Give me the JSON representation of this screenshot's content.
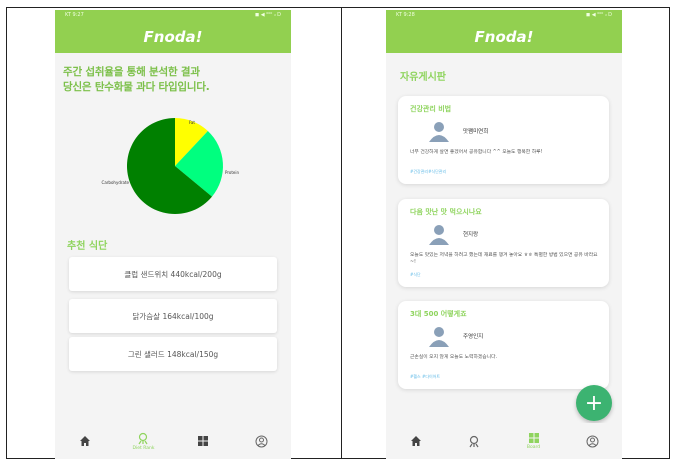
{
  "status_bar": {
    "left_time": "KT 9:27",
    "right_time": "KT 9:28",
    "indicators": "◼ ◀ ⁰⁰⁰ ᵢₗ D"
  },
  "app": {
    "title": "Fnoda!"
  },
  "analysis": {
    "line1": "주간 섭취율을 통해 분석한 결과",
    "line2": "당신은 탄수화물 과다 타입입니다."
  },
  "chart_data": {
    "type": "pie",
    "labels": [
      "Carbohydrate",
      "Protein",
      "Fat"
    ],
    "values": [
      64,
      24,
      12
    ],
    "colors": [
      "#008000",
      "#00ff7f",
      "#ffff00"
    ]
  },
  "recommend": {
    "title": "추천 식단",
    "items": [
      "클럽 샌드위치 440kcal/200g",
      "닭가슴살 164kcal/100g",
      "그린 샐러드 148kcal/150g"
    ]
  },
  "board": {
    "title": "자유게시판",
    "posts": [
      {
        "title": "건강관리 비법",
        "author": "맛쨈미연희",
        "body": "너무 건강하게 살면 좋겠어서 공유합니다 ^^ 오늘도 행복한 하루!",
        "tag": "#건강관리#식단관리"
      },
      {
        "title": "다음 맛난 맛 먹으시나요",
        "author": "현지랑",
        "body": "오늘도 맛있는 저녁을 하려고 했는데 재료를 챙겨 놓아요 ㅎㅎ 특별한 방법 있으면 공유 바라요~!",
        "tag": "#식단"
      },
      {
        "title": "3대 500 어떻게죠",
        "author": "주영인지",
        "body": "근손실이 오지 않게 오늘도 노력하겠습니다.",
        "tag": "#헬스 #다이어트"
      }
    ]
  },
  "nav": {
    "left_active_label": "Diet Rank",
    "right_active_label": "Board"
  }
}
